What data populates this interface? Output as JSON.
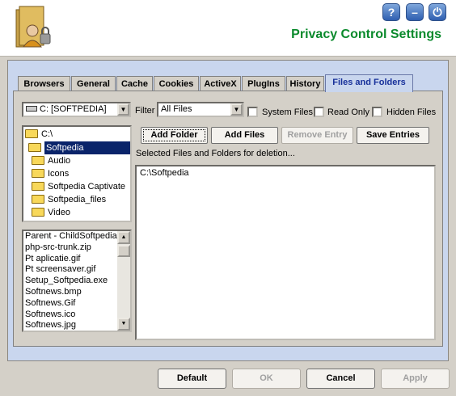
{
  "window": {
    "title": "Privacy Control Settings",
    "controls": [
      {
        "name": "help",
        "glyph": "?"
      },
      {
        "name": "minimize",
        "glyph": "–"
      },
      {
        "name": "power",
        "glyph": "⏻"
      }
    ]
  },
  "tabs": [
    "Browsers",
    "General",
    "Cache",
    "Cookies",
    "ActiveX",
    "PlugIns",
    "History",
    "Files and Folders"
  ],
  "active_tab": "Files and Folders",
  "drive": {
    "selected": "C: [SOFTPEDIA]"
  },
  "filter": {
    "label": "Filter",
    "selected": "All Files",
    "options": [
      {
        "label": "System Files",
        "checked": false
      },
      {
        "label": "Read Only",
        "checked": false
      },
      {
        "label": "Hidden Files",
        "checked": false
      }
    ]
  },
  "tree": {
    "root": "C:\\",
    "selected": "Softpedia",
    "children": [
      "Audio",
      "Icons",
      "Softpedia Captivate",
      "Softpedia_files",
      "Video"
    ]
  },
  "file_list": [
    "Parent - ChildSoftpedia.",
    "php-src-trunk.zip",
    "Pt aplicatie.gif",
    "Pt screensaver.gif",
    "Setup_Softpedia.exe",
    "Softnews.bmp",
    "Softnews.Gif",
    "Softnews.ico",
    "Softnews.jpg"
  ],
  "actions": {
    "add_folder": "Add Folder",
    "add_files": "Add Files",
    "remove_entry": "Remove Entry",
    "save_entries": "Save Entries"
  },
  "selection": {
    "caption": "Selected Files and Folders for deletion...",
    "items": [
      "C:\\Softpedia"
    ]
  },
  "footer": {
    "default": "Default",
    "ok": "OK",
    "cancel": "Cancel",
    "apply": "Apply"
  }
}
